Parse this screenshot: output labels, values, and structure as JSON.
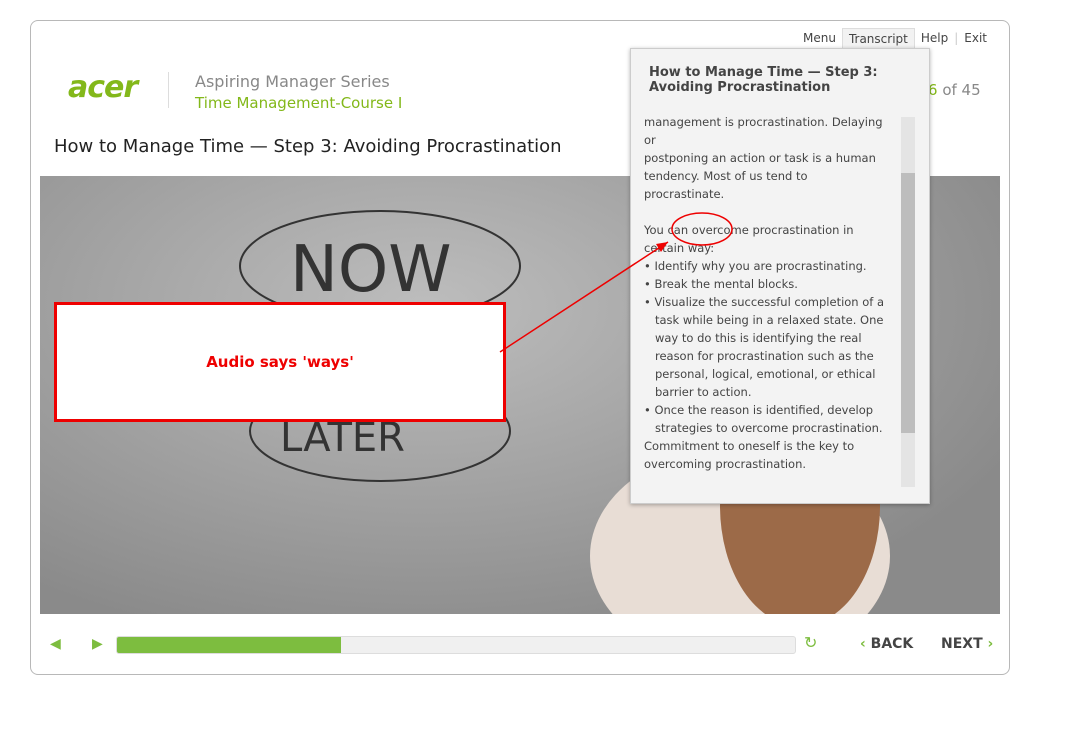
{
  "header": {
    "logo": "acer",
    "series": "Aspiring Manager Series",
    "course": "Time Management-Course I",
    "page_current": "6",
    "page_of": "of 45"
  },
  "topnav": [
    "Menu",
    "Transcript",
    "Help",
    "Exit"
  ],
  "slide_title": "How to Manage Time — Step 3: Avoiding Procrastination",
  "image_words": {
    "top": "NOW",
    "bottom": "LATER"
  },
  "transcript": {
    "title": "How to Manage Time — Step 3: Avoiding Procrastination",
    "text": "management is procrastination. Delaying or\npostponing an action or task is a human\ntendency. Most of us tend to\nprocrastinate.\n\nYou can overcome procrastination in\ncertain way:\n• Identify why you are procrastinating.\n• Break the mental blocks.\n• Visualize the successful completion of a\n   task while being in a relaxed state. One\n   way to do this is identifying the real\n   reason for procrastination such as the\n   personal, logical, emotional, or ethical\n   barrier to action.\n• Once the reason is identified, develop\n   strategies to overcome procrastination.\nCommitment to oneself is the key to\novercoming procrastination.\n\nIn the scenario we discussed, Kerry should"
  },
  "annotation": "Audio says 'ways'",
  "controls": {
    "progress_percent": 33,
    "back": "BACK",
    "next": "NEXT"
  },
  "colors": {
    "accent": "#7dbd3f",
    "annotation": "#e00000"
  }
}
